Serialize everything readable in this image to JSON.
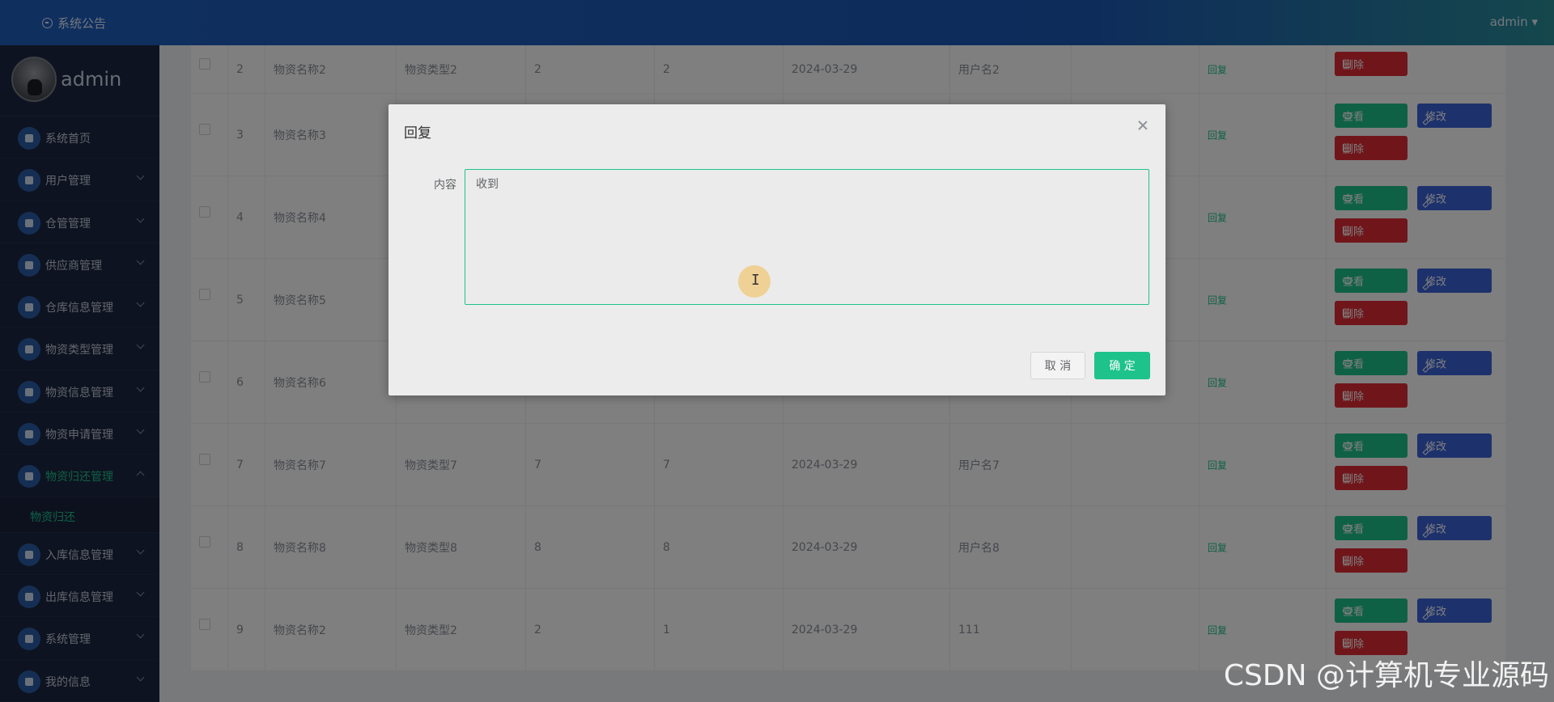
{
  "topbar": {
    "notice": "系统公告",
    "user": "admin ▾"
  },
  "sidebar": {
    "username": "admin",
    "items": [
      {
        "label": "系统首页",
        "chevron": false
      },
      {
        "label": "用户管理",
        "chevron": true
      },
      {
        "label": "仓管管理",
        "chevron": true
      },
      {
        "label": "供应商管理",
        "chevron": true
      },
      {
        "label": "仓库信息管理",
        "chevron": true
      },
      {
        "label": "物资类型管理",
        "chevron": true
      },
      {
        "label": "物资信息管理",
        "chevron": true
      },
      {
        "label": "物资申请管理",
        "chevron": true
      },
      {
        "label": "物资归还管理",
        "chevron": true,
        "open": true
      }
    ],
    "submenu_item": "物资归还",
    "items_after": [
      {
        "label": "入库信息管理"
      },
      {
        "label": "出库信息管理"
      },
      {
        "label": "系统管理"
      },
      {
        "label": "我的信息"
      }
    ]
  },
  "table": {
    "rows": [
      {
        "no": "2",
        "name": "物资名称2",
        "type": "物资类型2",
        "qty": "2",
        "ret": "2",
        "date": "2024-03-29",
        "user": "用户名2"
      },
      {
        "no": "3",
        "name": "物资名称3",
        "type": "",
        "qty": "",
        "ret": "",
        "date": "",
        "user": ""
      },
      {
        "no": "4",
        "name": "物资名称4",
        "type": "",
        "qty": "",
        "ret": "",
        "date": "",
        "user": ""
      },
      {
        "no": "5",
        "name": "物资名称5",
        "type": "",
        "qty": "",
        "ret": "",
        "date": "",
        "user": ""
      },
      {
        "no": "6",
        "name": "物资名称6",
        "type": "",
        "qty": "",
        "ret": "",
        "date": "",
        "user": ""
      },
      {
        "no": "7",
        "name": "物资名称7",
        "type": "物资类型7",
        "qty": "7",
        "ret": "7",
        "date": "2024-03-29",
        "user": "用户名7"
      },
      {
        "no": "8",
        "name": "物资名称8",
        "type": "物资类型8",
        "qty": "8",
        "ret": "8",
        "date": "2024-03-29",
        "user": "用户名8"
      },
      {
        "no": "9",
        "name": "物资名称2",
        "type": "物资类型2",
        "qty": "2",
        "ret": "1",
        "date": "2024-03-29",
        "user": "111"
      }
    ],
    "reply_link": "回复",
    "view_label": "查看",
    "edit_label": "修改",
    "delete_label": "删除"
  },
  "dialog": {
    "title": "回复",
    "field_label": "内容",
    "content_value": "收到",
    "cancel_label": "取 消",
    "ok_label": "确 定"
  },
  "watermark": "CSDN @计算机专业源码"
}
